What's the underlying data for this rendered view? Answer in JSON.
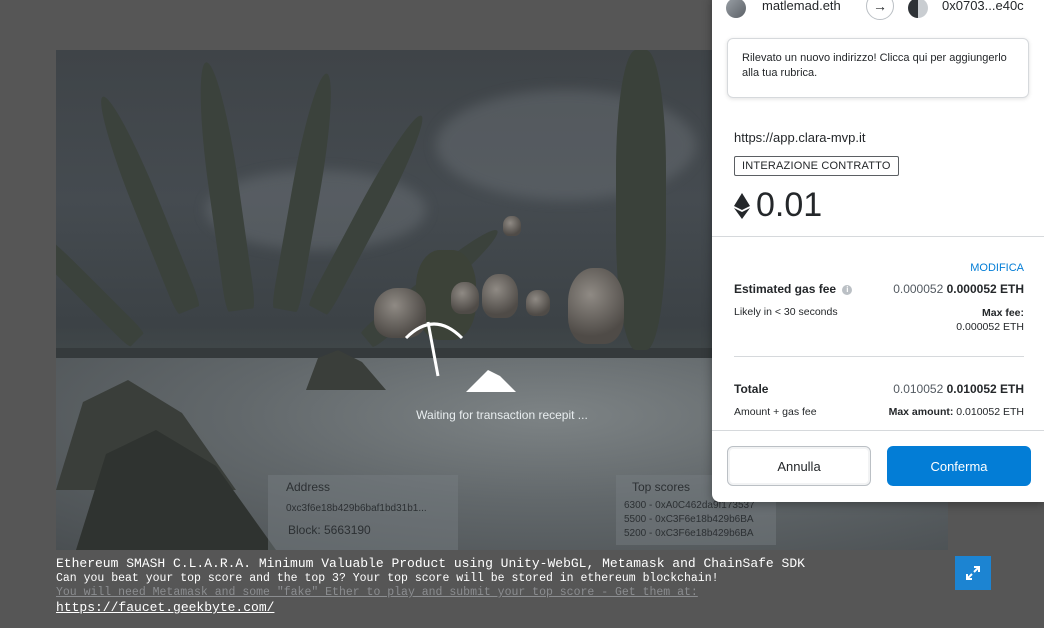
{
  "game": {
    "waiting_text": "Waiting for transaction recepit ...",
    "address_panel": {
      "title": "Address",
      "value": "0xc3f6e18b429b6baf1bd31b1...",
      "block_label": "Block: 5663190"
    },
    "scores_panel": {
      "title": "Top scores",
      "rows": [
        "6300 - 0xA0C462da9f173537",
        "5500 - 0xC3F6e18b429b6BA",
        "5200 - 0xC3F6e18b429b6BA"
      ]
    }
  },
  "footer": {
    "line1": "Ethereum SMASH C.L.A.R.A. Minimum Valuable Product using Unity-WebGL, Metamask and ChainSafe SDK",
    "line2": "Can you beat your top score and the top 3? Your top score will be stored in ethereum blockchain!",
    "line3": "You will need Metamask and some \"fake\" Ether to play and submit your top score - Get them at:",
    "line4": "https://faucet.geekbyte.com/",
    "expand_icon": "expand-icon"
  },
  "metamask": {
    "from_account": "matlemad.eth",
    "to_account": "0x0703...e40c",
    "notice": "Rilevato un nuovo indirizzo! Clicca qui per aggiungerlo alla tua rubrica.",
    "origin": "https://app.clara-mvp.it",
    "badge": "INTERAZIONE CONTRATTO",
    "amount": "0.01",
    "edit_label": "MODIFICA",
    "gas": {
      "label": "Estimated gas fee",
      "value_muted": "0.000052",
      "value_bold": "0.000052 ETH",
      "likely": "Likely in < 30 seconds",
      "max_fee_label": "Max fee:",
      "max_fee_value": "0.000052 ETH"
    },
    "total": {
      "label": "Totale",
      "value_muted": "0.010052",
      "value_bold": "0.010052 ETH",
      "sub_label": "Amount + gas fee",
      "max_amount_label": "Max amount:",
      "max_amount_value": "0.010052 ETH"
    },
    "cancel_label": "Annulla",
    "confirm_label": "Conferma",
    "colors": {
      "primary": "#037dd6",
      "text": "#24272a"
    }
  }
}
